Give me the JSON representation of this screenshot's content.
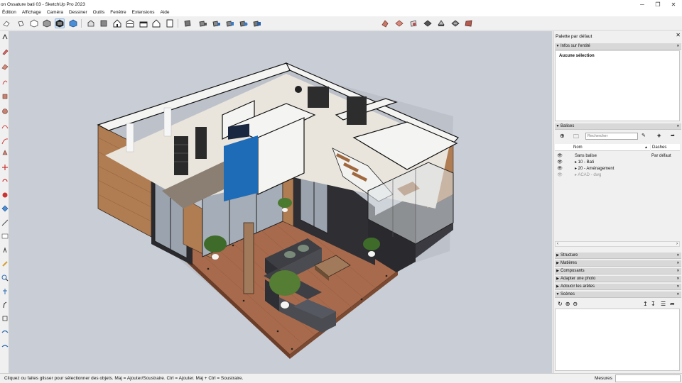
{
  "window": {
    "title": "on Ossature bati 03 - SketchUp Pro 2023",
    "minimize": "─",
    "restore": "❐",
    "close": "✕"
  },
  "menu": [
    "Édition",
    "Affichage",
    "Caméra",
    "Dessiner",
    "Outils",
    "Fenêtre",
    "Extensions",
    "Aide"
  ],
  "toolbar": {
    "icons": [
      "eraser-icon",
      "paint-bucket-icon",
      "cube-icon",
      "box-dark-icon",
      "xray-icon",
      "active-style-icon",
      "iso-view-icon",
      "top-view-icon",
      "front-view-icon",
      "right-view-icon",
      "back-view-icon",
      "left-view-icon",
      "bottom-view-icon",
      "section-plane-icon",
      "section-cut-icon",
      "section-fill-icon",
      "display-section-icon",
      "extension-warehouse-icon",
      "geo-location-icon",
      "terrain-icon",
      "sandbox-icon",
      "photo-texture-icon",
      "materials-icon"
    ],
    "active": "active-style-icon"
  },
  "left_tools": [
    "orbit-icon",
    "pencil-icon",
    "eraser-icon",
    "line-icon",
    "rectangle-icon",
    "circle-icon",
    "arc-icon",
    "polygon-icon",
    "push-pull-icon",
    "move-icon",
    "rotate-icon",
    "scale-icon",
    "offset-icon",
    "follow-me-icon",
    "tape-measure-icon",
    "dimension-icon",
    "text-icon",
    "axes-icon",
    "protractor-icon",
    "paint-icon",
    "walk-icon",
    "look-around-icon",
    "zoom-icon",
    "zoom-extents-icon",
    "section-icon"
  ],
  "panel": {
    "title": "Palette par défaut",
    "close": "✕",
    "entity": {
      "header": "Infos sur l'entité",
      "text": "Aucune sélection"
    },
    "tags": {
      "header": "Balises",
      "search_placeholder": "Rechercher",
      "col_name": "Nom",
      "col_dashes": "Dashes",
      "rows": [
        {
          "eye": "👁",
          "name": "Sans balise",
          "dashes": "Par défaut"
        },
        {
          "eye": "👁",
          "name": "▸ 10 - Bati",
          "dashes": ""
        },
        {
          "eye": "👁",
          "name": "▸ 20 - Aménagement",
          "dashes": ""
        },
        {
          "eye": "👁",
          "name": "▸ ACAD - dwg",
          "dashes": ""
        }
      ],
      "scroll_left": "‹",
      "scroll_right": "›"
    },
    "sections": [
      "Structure",
      "Matières",
      "Composants",
      "Adapter une photo",
      "Adoucir les arêtes",
      "Scènes"
    ],
    "scene_controls": [
      "↻",
      "⊕",
      "⊖"
    ]
  },
  "status": {
    "message": "Cliquez ou faites glisser pour sélectionner des objets. Maj = Ajouter/Soustraire. Ctrl = Ajouter. Maj + Ctrl = Soustraire.",
    "measure_label": "Mesures",
    "measure_value": ""
  },
  "colors": {
    "viewport_bg": "#c8cdd6",
    "deck": "#a86a4c",
    "wood_cladding": "#b07c52",
    "dark_cladding": "#2a2a2e",
    "wall_top": "#f4f4f2",
    "accent_blue": "#1e6bb8"
  }
}
